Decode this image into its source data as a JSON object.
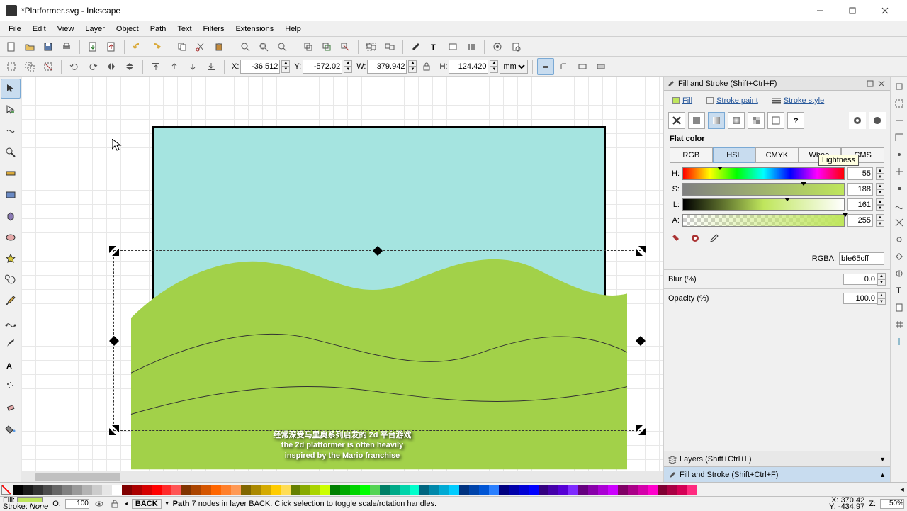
{
  "window": {
    "title": "*Platformer.svg - Inkscape"
  },
  "menu": {
    "items": [
      "File",
      "Edit",
      "View",
      "Layer",
      "Object",
      "Path",
      "Text",
      "Filters",
      "Extensions",
      "Help"
    ]
  },
  "toolbar2": {
    "x_label": "X:",
    "x_value": "-36.512",
    "y_label": "Y:",
    "y_value": "-572.02",
    "w_label": "W:",
    "w_value": "379.942",
    "h_label": "H:",
    "h_value": "124.420",
    "unit": "mm"
  },
  "panel": {
    "title": "Fill and Stroke (Shift+Ctrl+F)",
    "tabs": {
      "fill": "Fill",
      "stroke_paint": "Stroke paint",
      "stroke_style": "Stroke style"
    },
    "flat_color": "Flat color",
    "color_tabs": [
      "RGB",
      "HSL",
      "CMYK",
      "Wheel",
      "CMS"
    ],
    "active_color_tab": "HSL",
    "sliders": {
      "h": {
        "label": "H:",
        "value": "55"
      },
      "s": {
        "label": "S:",
        "value": "188"
      },
      "l": {
        "label": "L:",
        "value": "161"
      },
      "a": {
        "label": "A:",
        "value": "255"
      }
    },
    "tooltip": "Lightness",
    "rgba_label": "RGBA:",
    "rgba_value": "bfe65cff",
    "blur_label": "Blur (%)",
    "blur_value": "0.0",
    "opacity_label": "Opacity (%)",
    "opacity_value": "100.0"
  },
  "collapsed_panels": {
    "layers": "Layers (Shift+Ctrl+L)",
    "fillstroke": "Fill and Stroke (Shift+Ctrl+F)"
  },
  "status": {
    "fill_label": "Fill:",
    "stroke_label": "Stroke:",
    "stroke_value": "None",
    "o_label": "O:",
    "o_value": "100",
    "layer_name": "BACK",
    "message_strong": "Path",
    "message": " 7 nodes in layer BACK. Click selection to toggle scale/rotation handles.",
    "x_label": "X:",
    "x_value": "370.42",
    "y_label": "Y:",
    "y_value": "-434.97",
    "z_label": "Z:",
    "z_value": "50%"
  },
  "subtitles": {
    "line1": "经常深受马里奥系列启发的 2d 平台游戏",
    "line2": "the 2d platformer is often heavily",
    "line3": "inspired by the Mario franchise"
  }
}
